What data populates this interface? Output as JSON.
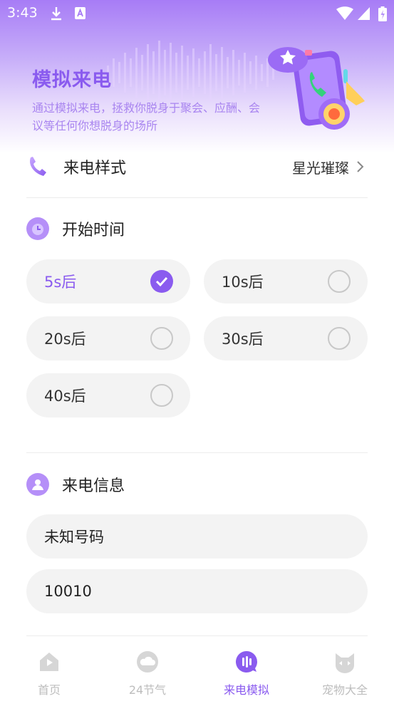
{
  "status_bar": {
    "time": "3:43"
  },
  "hero": {
    "title": "模拟来电",
    "subtitle": "通过模拟来电，拯救你脱身于聚会、应酬、会议等任何你想脱身的场所"
  },
  "call_style": {
    "label": "来电样式",
    "value": "星光璀璨"
  },
  "start_time": {
    "heading": "开始时间",
    "options": [
      {
        "label": "5s后",
        "selected": true
      },
      {
        "label": "10s后",
        "selected": false
      },
      {
        "label": "20s后",
        "selected": false
      },
      {
        "label": "30s后",
        "selected": false
      },
      {
        "label": "40s后",
        "selected": false
      }
    ]
  },
  "call_info": {
    "heading": "来电信息",
    "name_value": "未知号码",
    "number_value": "10010"
  },
  "tabs": [
    {
      "label": "首页",
      "icon": "home-icon",
      "active": false
    },
    {
      "label": "24节气",
      "icon": "cloud-icon",
      "active": false
    },
    {
      "label": "来电模拟",
      "icon": "call-sim-icon",
      "active": true
    },
    {
      "label": "宠物大全",
      "icon": "cat-icon",
      "active": false
    }
  ],
  "colors": {
    "accent": "#8a5bef",
    "option_bg": "#f3f3f3",
    "inactive_tab": "#bdbdbd"
  }
}
